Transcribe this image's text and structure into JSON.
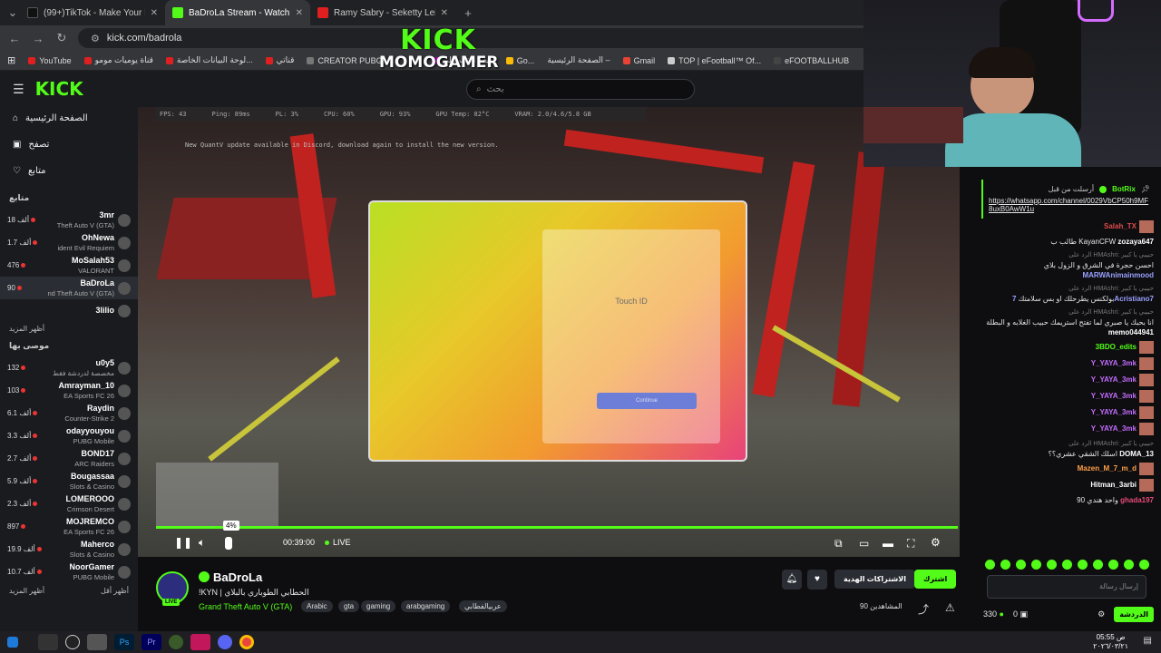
{
  "tabs": [
    {
      "label": "(99+)TikTok - Make Your Day",
      "color": "#111111"
    },
    {
      "label": "BaDroLa Stream - Watch Live",
      "color": "#53fc18"
    },
    {
      "label": "Ramy Sabry - Seketty Leih (Dub",
      "color": "#e02020"
    }
  ],
  "address": {
    "url": "kick.com/badrola"
  },
  "bookmarks": [
    "YouTube",
    "قناة يوميات مومو",
    "لوحة البيانات الخاصة...",
    "قناتي",
    "CREATOR PUBG",
    "كيف تكتب علي",
    "Go...",
    "الصفحة الرئيسية –",
    "Gmail",
    "TOP | eFootball™ Of...",
    "eFOOTBALLHUB"
  ],
  "overlay": {
    "brand": "KICK",
    "name": "MOMOGAMER"
  },
  "site": {
    "logo": "KICK",
    "search_placeholder": "بحث"
  },
  "sidebar": {
    "nav": [
      "الصفحة الرئيسية",
      "تصفح",
      "متابع"
    ],
    "following_title": "متابع",
    "following": [
      {
        "name": "3mr",
        "game": "Theft Auto V (GTA)",
        "viewers": "18 ألف"
      },
      {
        "name": "OhNewa",
        "game": "ident Evil Requiem",
        "viewers": "1.7 ألف"
      },
      {
        "name": "MoSalah53",
        "game": "VALORANT",
        "viewers": "476"
      },
      {
        "name": "BaDroLa",
        "game": "nd Theft Auto V (GTA)",
        "viewers": "90"
      },
      {
        "name": "3lilio",
        "game": "",
        "viewers": ""
      }
    ],
    "show_more": "أظهر المزيد",
    "recommended_title": "موصى بها",
    "recommended": [
      {
        "name": "u0y5",
        "game": "مخصصة لدردشة فقط",
        "viewers": "132"
      },
      {
        "name": "Amrayman_10",
        "game": "EA Sports FC 26",
        "viewers": "103"
      },
      {
        "name": "Raydin",
        "game": "Counter-Strike 2",
        "viewers": "6.1 ألف"
      },
      {
        "name": "odayyouyou",
        "game": "PUBG Mobile",
        "viewers": "3.3 ألف"
      },
      {
        "name": "BOND17",
        "game": "ARC Raiders",
        "viewers": "2.7 ألف"
      },
      {
        "name": "Bougassaa",
        "game": "Slots & Casino",
        "viewers": "5.9 ألف"
      },
      {
        "name": "LOMEROOO",
        "game": "Crimson Desert",
        "viewers": "2.3 ألف"
      },
      {
        "name": "MOJREMCO",
        "game": "EA Sports FC 26",
        "viewers": "897"
      },
      {
        "name": "Maherco",
        "game": "Slots & Casino",
        "viewers": "19.9 ألف"
      },
      {
        "name": "NoorGamer",
        "game": "PUBG Mobile",
        "viewers": "10.7 ألف"
      }
    ],
    "show_more2": "أظهر المزيد",
    "show_less": "أظهر أقل"
  },
  "player": {
    "hud": [
      "FPS: 43",
      "Ping: 89ms",
      "PL: 3%",
      "CPU: 60%",
      "GPU: 93%",
      "GPU Temp: 82°C",
      "VRAM: 2.0/4.6/5.8 GB"
    ],
    "notice": "New QuantV update available in Discord, download again to install the new version.",
    "popup_title": "Touch ID",
    "popup_btn": "Continue",
    "volume_tip": "4%",
    "time": "00:39:00",
    "live": "LIVE"
  },
  "chat": {
    "pinned_user": "BotRix",
    "pinned_by": "أرسلت من قبل",
    "pinned_link": "https://whatsapp.com/channel/0029VbCP50h9MF8uxB0AwW1u",
    "messages": [
      {
        "user": "Salah_TX",
        "text": "",
        "color": "#e04b4b"
      },
      {
        "user": "zozaya647",
        "text": "طالب ب KayanCFW",
        "color": "#ffffff"
      },
      {
        "reply": "الرد على HMAshri: حبيبي يا كبير",
        "user": "MARWAnimainmood",
        "text": "احسن حجرة في الشرق و الزول بلاي",
        "color": "#9aa0ff"
      },
      {
        "reply": "الرد على HMAshri: حبيبي يا كبير",
        "user": "7Acristiano7",
        "text": "بولكنس يطرحلك او بس سلامتك",
        "color": "#9aa0ff"
      },
      {
        "reply": "الرد على HMAshri: حبيبي يا كبير",
        "user": "memo044941",
        "text": "انا بحبك يا صبري لما تفتح استريمك حبيب الغلابه و البطلة",
        "color": "#ffffff"
      },
      {
        "user": "3BDO_edits",
        "text": "",
        "color": "#53fc18"
      },
      {
        "user": "Y_YAYA_3mk",
        "text": "",
        "color": "#c46cff"
      },
      {
        "user": "Y_YAYA_3mk",
        "text": "",
        "color": "#c46cff"
      },
      {
        "user": "Y_YAYA_3mk",
        "text": "",
        "color": "#c46cff"
      },
      {
        "user": "Y_YAYA_3mk",
        "text": "",
        "color": "#c46cff"
      },
      {
        "user": "Y_YAYA_3mk",
        "text": "",
        "color": "#c46cff"
      },
      {
        "reply": "الرد على HMAshri: حبيبي يا كبير",
        "user": "DOMA_13",
        "text": "اسلك الشقي عشري؟؟",
        "color": "#ffffff"
      },
      {
        "user": "Mazen_M_7_m_d",
        "text": "",
        "color": "#ff9f4a"
      },
      {
        "user": "Hitman_3arbi",
        "text": "",
        "color": "#ffffff"
      },
      {
        "user": "ghada197",
        "text": "واحد هندي 90",
        "color": "#e84a7a"
      }
    ],
    "input_placeholder": "إرسال رسالة",
    "points": "330",
    "count": "0",
    "send": "الدردشة"
  },
  "stream": {
    "name": "BaDroLa",
    "title": "!KYN | الحطابي الطوباري بالبلاي",
    "category": "Grand Theft Auto V (GTA)",
    "tags": [
      "Arabic",
      "gta",
      "gaming",
      "arabgaming",
      "عربيالفطابي"
    ],
    "subscribe": "اشترك",
    "gift": "الاشتراكات الهدية",
    "viewers": "المشاهدين 90",
    "live_badge": "LIVE"
  },
  "taskbar": {
    "time": "05:55 ص",
    "date": "٢٠٢٦/٠٣/٢١"
  }
}
